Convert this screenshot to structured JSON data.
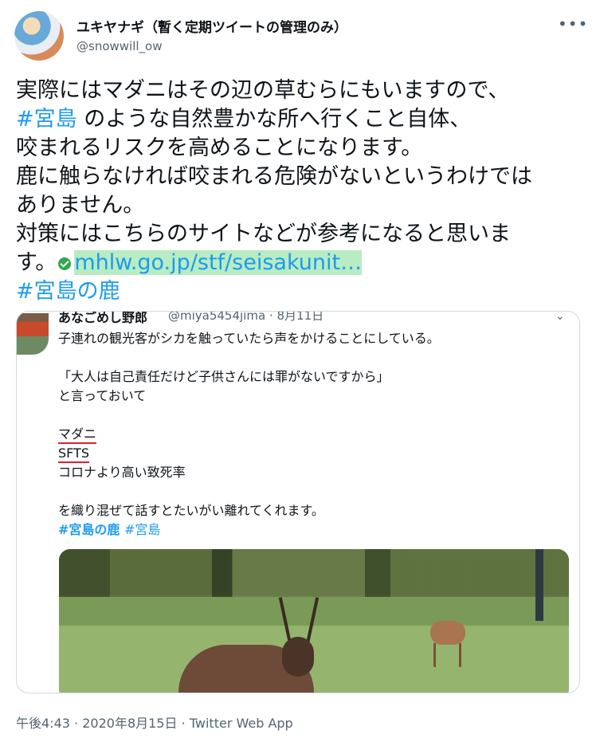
{
  "author": {
    "name": "ユキヤナギ（暫く定期ツイートの管理のみ）",
    "handle": "@snowwill_ow"
  },
  "more_icon": "more-horizontal-icon",
  "tweet": {
    "line1": "実際にはマダニはその辺の草むらにもいますので、",
    "line2_tag": "#宮島",
    "line2_rest": " のような自然豊かな所へ行くこと自体、",
    "line3": "咬まれるリスクを高めることになります。",
    "line4": "鹿に触らなければ咬まれる危険がないというわけでは",
    "line5": "ありません。",
    "line6": "対策にはこちらのサイトなどが参考になると思いま",
    "line7_prefix": "す。",
    "link_text": "mhlw.go.jp/stf/seisakunit…",
    "hashtag_last": "#宮島の鹿"
  },
  "quote": {
    "name": "あなごめし野郎",
    "handle": "@miya5454jima",
    "date": "8月11日",
    "lines": {
      "l1": "子連れの観光客がシカを触っていたら声をかけることにしている。",
      "l2": "「大人は自己責任だけど子供さんには罪がないですから」",
      "l3": "と言っておいて",
      "l4": "マダニ",
      "l5": "SFTS",
      "l6": "コロナより高い致死率",
      "l7": "を織り混ぜて話すとたいがい離れてくれます。"
    },
    "tag1": "#宮島の鹿",
    "tag2": "#宮島",
    "chevron_icon": "chevron-down-icon"
  },
  "footer": {
    "time": "午後4:43",
    "date": "2020年8月15日",
    "source": "Twitter Web App",
    "separator": "·"
  },
  "colors": {
    "link": "#1d9bf0",
    "link_highlight": "#b8ecc2",
    "underline": "#e0212b",
    "text": "#0f1419",
    "muted": "#536471"
  }
}
